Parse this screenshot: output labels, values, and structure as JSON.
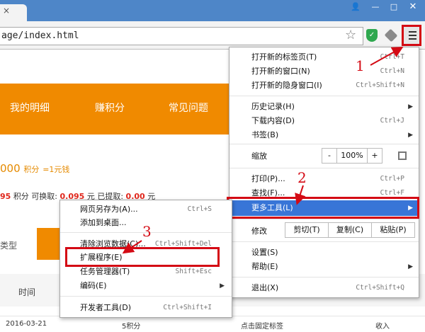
{
  "browser": {
    "tab_close": "×",
    "url": "age/index.html",
    "window_controls": [
      "👤",
      "—",
      "□",
      "✕"
    ],
    "star_icon": "star-icon",
    "shield_icon": "shield-icon"
  },
  "page": {
    "nav": [
      "我的明细",
      "赚积分",
      "常见问题"
    ],
    "points_big": "000",
    "points_unit": "积分",
    "points_eq": "=1元钱",
    "points_line": {
      "a": "95",
      "b": "积分",
      "c": "可换取:",
      "d": "0.095",
      "e": "元",
      "f": "已提取:",
      "g": "0.00",
      "h": "元"
    },
    "side_type": "类型",
    "time_label": "时间",
    "row": {
      "date": "2016-03-21",
      "points": "5积分",
      "desc": "点击固定标签",
      "type": "收入"
    }
  },
  "menu": {
    "items_top": [
      {
        "label": "打开新的标签页(T)",
        "shortcut": "Ctrl+T"
      },
      {
        "label": "打开新的窗口(N)",
        "shortcut": "Ctrl+N"
      },
      {
        "label": "打开新的隐身窗口(I)",
        "shortcut": "Ctrl+Shift+N"
      }
    ],
    "items_mid": [
      {
        "label": "历史记录(H)",
        "shortcut": ""
      },
      {
        "label": "下载内容(D)",
        "shortcut": "Ctrl+J"
      },
      {
        "label": "书签(B)",
        "shortcut": ""
      }
    ],
    "zoom": {
      "label": "缩放",
      "minus": "-",
      "value": "100%",
      "plus": "+"
    },
    "print": {
      "label": "打印(P)...",
      "shortcut": "Ctrl+P"
    },
    "find": {
      "label": "查找(F)...",
      "shortcut": "Ctrl+F"
    },
    "more_tools": {
      "label": "更多工具(L)"
    },
    "edit": {
      "label": "修改",
      "cut": "剪切(T)",
      "copy": "复制(C)",
      "paste": "粘贴(P)"
    },
    "settings": {
      "label": "设置(S)"
    },
    "help": {
      "label": "帮助(E)"
    },
    "exit": {
      "label": "退出(X)",
      "shortcut": "Ctrl+Shift+Q"
    }
  },
  "submenu": {
    "items": [
      {
        "label": "网页另存为(A)...",
        "shortcut": "Ctrl+S"
      },
      {
        "label": "添加到桌面...",
        "shortcut": ""
      },
      {
        "label": "清除浏览数据(C)...",
        "shortcut": "Ctrl+Shift+Del"
      },
      {
        "label": "扩展程序(E)",
        "shortcut": ""
      },
      {
        "label": "任务管理器(T)",
        "shortcut": "Shift+Esc"
      },
      {
        "label": "编码(E)",
        "shortcut": ""
      },
      {
        "label": "开发者工具(D)",
        "shortcut": "Ctrl+Shift+I"
      }
    ]
  },
  "annotations": [
    "1",
    "2",
    "3"
  ],
  "colors": {
    "accent": "#d40a14",
    "orange": "#f08a00",
    "highlight": "#3875d7"
  }
}
